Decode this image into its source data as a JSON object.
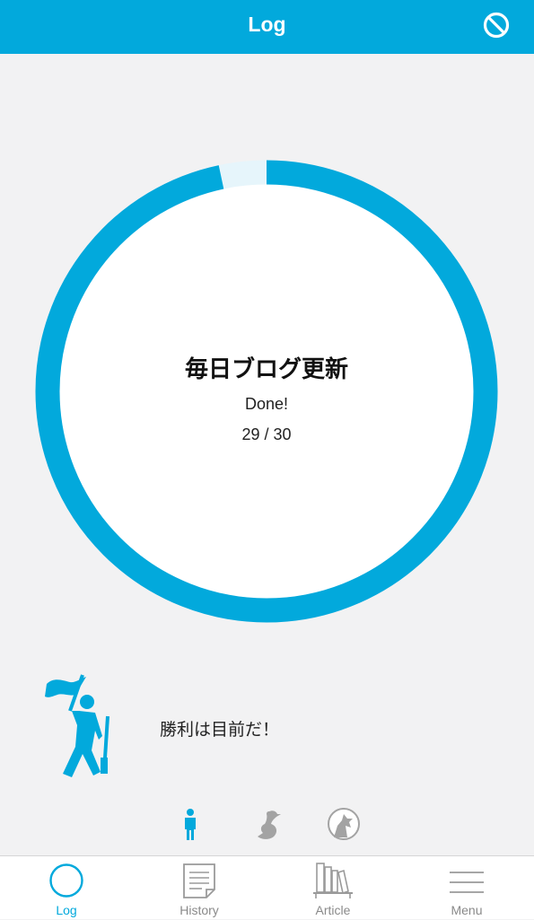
{
  "header": {
    "title": "Log",
    "action_icon": "block-icon"
  },
  "goal": {
    "title": "毎日ブログ更新",
    "status": "Done!",
    "count_text": "29 / 30",
    "completed": 29,
    "total": 30
  },
  "mascot": {
    "icon": "flag-bearer-icon",
    "message": "勝利は目前だ！"
  },
  "character_selector": [
    {
      "name": "person",
      "icon": "person-icon",
      "selected": true
    },
    {
      "name": "bird",
      "icon": "bird-icon",
      "selected": false
    },
    {
      "name": "wolf",
      "icon": "wolf-icon",
      "selected": false
    }
  ],
  "tabs": [
    {
      "label": "Log",
      "icon": "circle-icon",
      "active": true
    },
    {
      "label": "History",
      "icon": "document-icon",
      "active": false
    },
    {
      "label": "Article",
      "icon": "bookshelf-icon",
      "active": false
    },
    {
      "label": "Menu",
      "icon": "menu-icon",
      "active": false
    }
  ],
  "colors": {
    "accent": "#02a9dc",
    "ring_remaining": "#e6f5fb",
    "background": "#f2f2f3",
    "inactive_icon": "#9a9a9a"
  }
}
